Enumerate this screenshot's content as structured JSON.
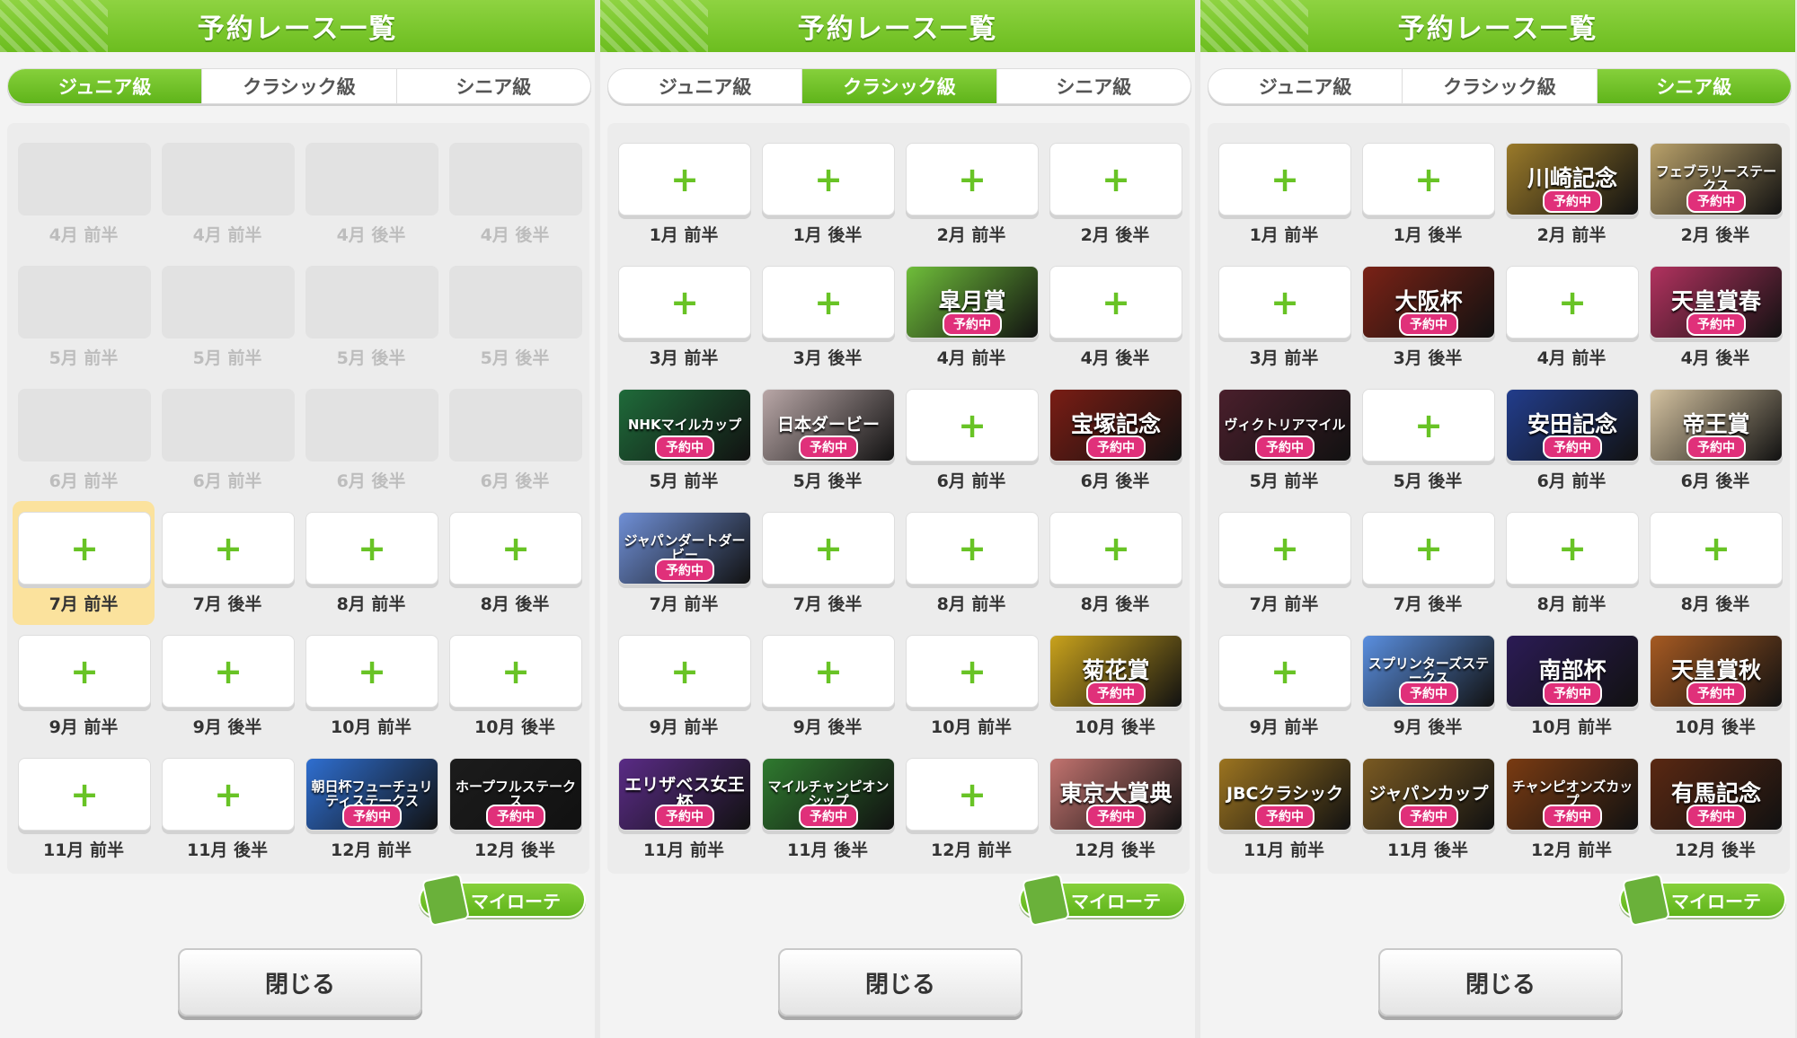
{
  "panels": [
    {
      "title": "予約レース一覧",
      "tabs": [
        {
          "label": "ジュニア級",
          "active": true
        },
        {
          "label": "クラシック級",
          "active": false
        },
        {
          "label": "シニア級",
          "active": false
        }
      ],
      "slots": [
        {
          "label": "4月 前半",
          "state": "disabled"
        },
        {
          "label": "4月 前半",
          "state": "disabled"
        },
        {
          "label": "4月 後半",
          "state": "disabled"
        },
        {
          "label": "4月 後半",
          "state": "disabled"
        },
        {
          "label": "5月 前半",
          "state": "disabled"
        },
        {
          "label": "5月 前半",
          "state": "disabled"
        },
        {
          "label": "5月 後半",
          "state": "disabled"
        },
        {
          "label": "5月 後半",
          "state": "disabled"
        },
        {
          "label": "6月 前半",
          "state": "disabled"
        },
        {
          "label": "6月 前半",
          "state": "disabled"
        },
        {
          "label": "6月 後半",
          "state": "disabled"
        },
        {
          "label": "6月 後半",
          "state": "disabled"
        },
        {
          "label": "7月 前半",
          "state": "empty",
          "current": true
        },
        {
          "label": "7月 後半",
          "state": "empty"
        },
        {
          "label": "8月 前半",
          "state": "empty"
        },
        {
          "label": "8月 後半",
          "state": "empty"
        },
        {
          "label": "9月 前半",
          "state": "empty"
        },
        {
          "label": "9月 後半",
          "state": "empty"
        },
        {
          "label": "10月 前半",
          "state": "empty"
        },
        {
          "label": "10月 後半",
          "state": "empty"
        },
        {
          "label": "11月 前半",
          "state": "empty"
        },
        {
          "label": "11月 後半",
          "state": "empty"
        },
        {
          "label": "12月 前半",
          "state": "race",
          "race": "朝日杯フューチュリティステークス",
          "color": "#2f6fd1"
        },
        {
          "label": "12月 後半",
          "state": "race",
          "race": "ホープフルステークス",
          "color": "#1c1c1c"
        }
      ],
      "myrote_label": "マイローテ",
      "close_label": "閉じる"
    },
    {
      "title": "予約レース一覧",
      "tabs": [
        {
          "label": "ジュニア級",
          "active": false
        },
        {
          "label": "クラシック級",
          "active": true
        },
        {
          "label": "シニア級",
          "active": false
        }
      ],
      "slots": [
        {
          "label": "1月 前半",
          "state": "empty"
        },
        {
          "label": "1月 後半",
          "state": "empty"
        },
        {
          "label": "2月 前半",
          "state": "empty"
        },
        {
          "label": "2月 後半",
          "state": "empty"
        },
        {
          "label": "3月 前半",
          "state": "empty"
        },
        {
          "label": "3月 後半",
          "state": "empty"
        },
        {
          "label": "4月 前半",
          "state": "race",
          "race": "皐月賞",
          "color": "#6fbe3a"
        },
        {
          "label": "4月 後半",
          "state": "empty"
        },
        {
          "label": "5月 前半",
          "state": "race",
          "race": "NHKマイルカップ",
          "color": "#1f6b3a"
        },
        {
          "label": "5月 後半",
          "state": "race",
          "race": "日本ダービー",
          "color": "#b9a7a7"
        },
        {
          "label": "6月 前半",
          "state": "empty"
        },
        {
          "label": "6月 後半",
          "state": "race",
          "race": "宝塚記念",
          "color": "#7a1d14"
        },
        {
          "label": "7月 前半",
          "state": "race",
          "race": "ジャパンダートダービー",
          "color": "#6f8fd6"
        },
        {
          "label": "7月 後半",
          "state": "empty"
        },
        {
          "label": "8月 前半",
          "state": "empty"
        },
        {
          "label": "8月 後半",
          "state": "empty"
        },
        {
          "label": "9月 前半",
          "state": "empty"
        },
        {
          "label": "9月 後半",
          "state": "empty"
        },
        {
          "label": "10月 前半",
          "state": "empty"
        },
        {
          "label": "10月 後半",
          "state": "race",
          "race": "菊花賞",
          "color": "#c9a21c"
        },
        {
          "label": "11月 前半",
          "state": "race",
          "race": "エリザベス女王杯",
          "color": "#5a2b86"
        },
        {
          "label": "11月 後半",
          "state": "race",
          "race": "マイルチャンピオンシップ",
          "color": "#2f7a2f"
        },
        {
          "label": "12月 前半",
          "state": "empty"
        },
        {
          "label": "12月 後半",
          "state": "race",
          "race": "東京大賞典",
          "color": "#c2736f"
        }
      ],
      "myrote_label": "マイローテ",
      "close_label": "閉じる"
    },
    {
      "title": "予約レース一覧",
      "tabs": [
        {
          "label": "ジュニア級",
          "active": false
        },
        {
          "label": "クラシック級",
          "active": false
        },
        {
          "label": "シニア級",
          "active": true
        }
      ],
      "slots": [
        {
          "label": "1月 前半",
          "state": "empty"
        },
        {
          "label": "1月 後半",
          "state": "empty"
        },
        {
          "label": "2月 前半",
          "state": "race",
          "race": "川崎記念",
          "color": "#9a7a2a"
        },
        {
          "label": "2月 後半",
          "state": "race",
          "race": "フェブラリーステークス",
          "color": "#b9a16a"
        },
        {
          "label": "3月 前半",
          "state": "empty"
        },
        {
          "label": "3月 後半",
          "state": "race",
          "race": "大阪杯",
          "color": "#7a2216"
        },
        {
          "label": "4月 前半",
          "state": "empty"
        },
        {
          "label": "4月 後半",
          "state": "race",
          "race": "天皇賞春",
          "color": "#b2325f"
        },
        {
          "label": "5月 前半",
          "state": "race",
          "race": "ヴィクトリアマイル",
          "color": "#4a1f2c"
        },
        {
          "label": "5月 後半",
          "state": "empty"
        },
        {
          "label": "6月 前半",
          "state": "race",
          "race": "安田記念",
          "color": "#223d8c"
        },
        {
          "label": "6月 後半",
          "state": "race",
          "race": "帝王賞",
          "color": "#d4c2a0"
        },
        {
          "label": "7月 前半",
          "state": "empty"
        },
        {
          "label": "7月 後半",
          "state": "empty"
        },
        {
          "label": "8月 前半",
          "state": "empty"
        },
        {
          "label": "8月 後半",
          "state": "empty"
        },
        {
          "label": "9月 前半",
          "state": "empty"
        },
        {
          "label": "9月 後半",
          "state": "race",
          "race": "スプリンターズステークス",
          "color": "#5a8fe0"
        },
        {
          "label": "10月 前半",
          "state": "race",
          "race": "南部杯",
          "color": "#2b1b55"
        },
        {
          "label": "10月 後半",
          "state": "race",
          "race": "天皇賞秋",
          "color": "#a65a22"
        },
        {
          "label": "11月 前半",
          "state": "race",
          "race": "JBCクラシック",
          "color": "#9c7420"
        },
        {
          "label": "11月 後半",
          "state": "race",
          "race": "ジャパンカップ",
          "color": "#7a5a22"
        },
        {
          "label": "12月 前半",
          "state": "race",
          "race": "チャンピオンズカップ",
          "color": "#7a3b12"
        },
        {
          "label": "12月 後半",
          "state": "race",
          "race": "有馬記念",
          "color": "#5a2812"
        }
      ],
      "myrote_label": "マイローテ",
      "close_label": "閉じる"
    }
  ],
  "badge_label": "予約中",
  "plus_glyph": "+"
}
